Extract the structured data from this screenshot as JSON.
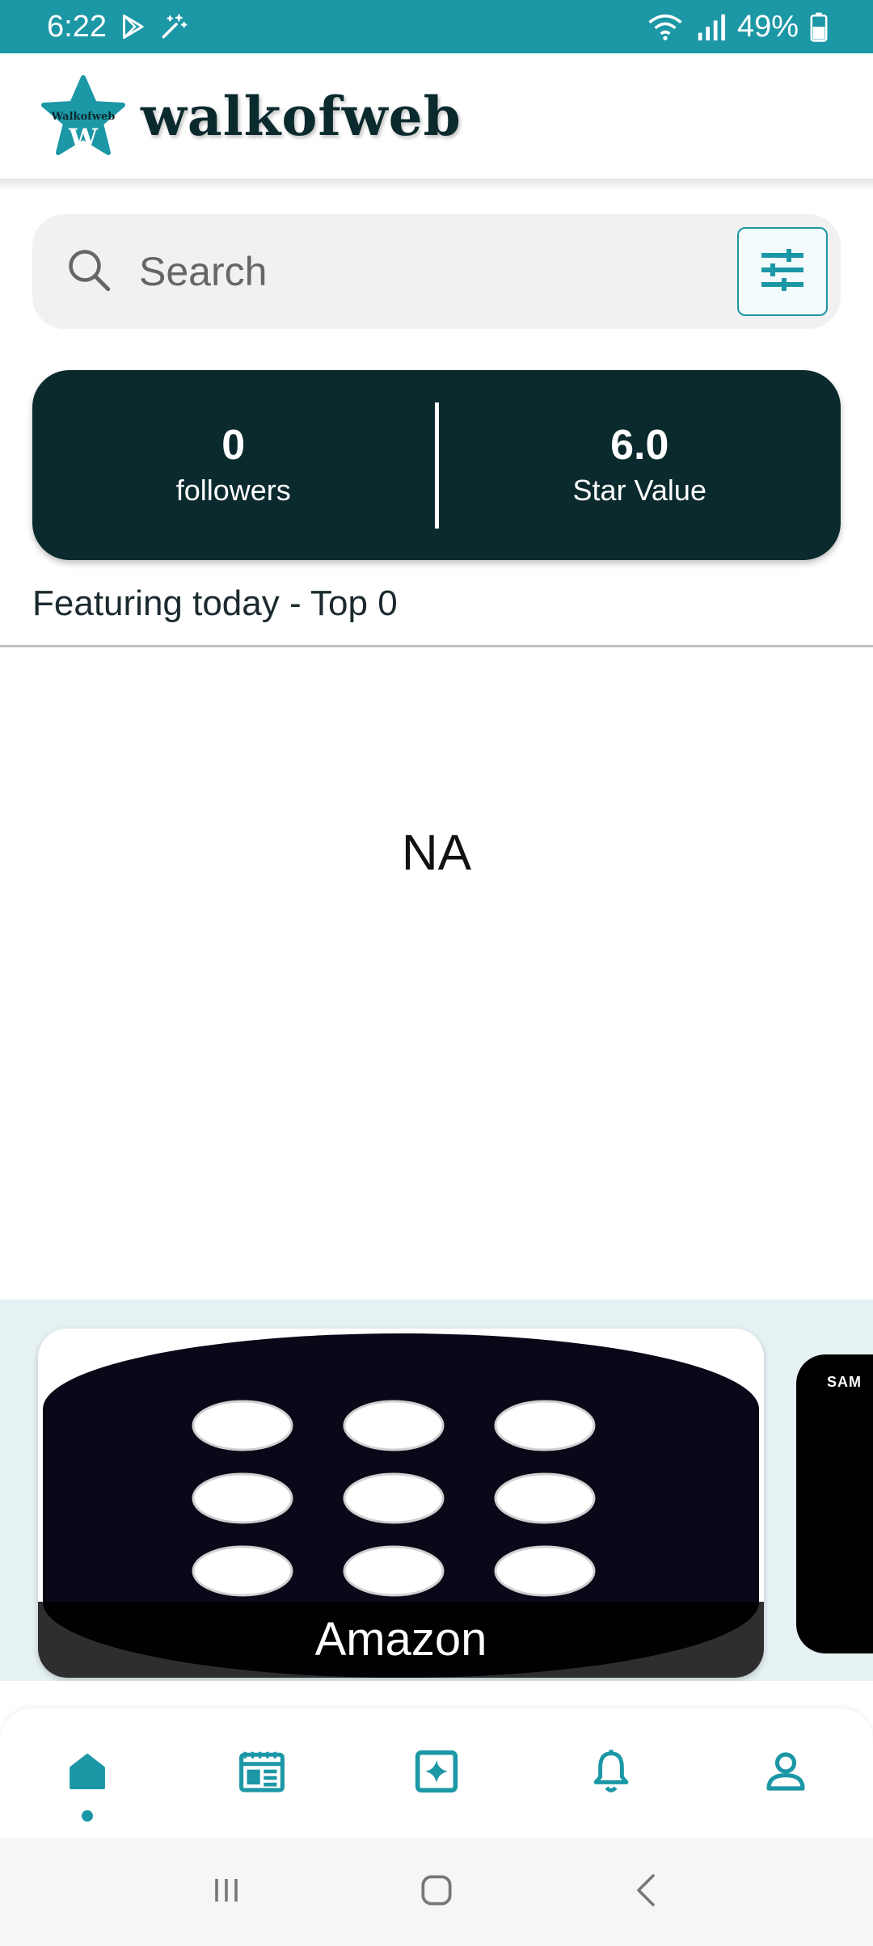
{
  "status_bar": {
    "time": "6:22",
    "battery": "49%"
  },
  "header": {
    "logo_badge_text": "Walkofweb",
    "logo_letter": "W",
    "app_name": "walkofweb"
  },
  "search": {
    "placeholder": "Search"
  },
  "stats": {
    "followers_value": "0",
    "followers_label": "followers",
    "star_value": "6.0",
    "star_label": "Star Value"
  },
  "featuring": {
    "title": "Featuring today - Top 0",
    "empty_text": "NA"
  },
  "carousel": {
    "cards": [
      {
        "label": "Amazon"
      }
    ],
    "peek_label": "SAM"
  },
  "bottom_nav": {
    "items": [
      {
        "icon": "home-icon",
        "active": true
      },
      {
        "icon": "feed-icon",
        "active": false
      },
      {
        "icon": "sparkle-icon",
        "active": false
      },
      {
        "icon": "bell-icon",
        "active": false
      },
      {
        "icon": "profile-icon",
        "active": false
      }
    ]
  },
  "colors": {
    "accent": "#1c97a6",
    "dark": "#0b2a2e"
  }
}
